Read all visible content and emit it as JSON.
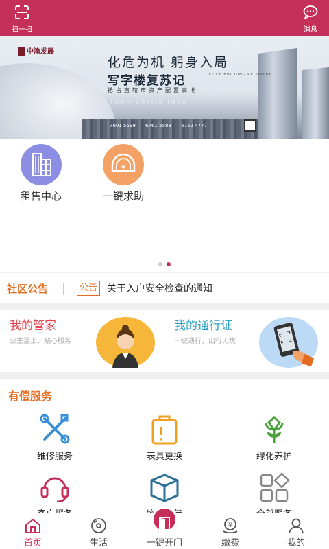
{
  "header": {
    "scan_label": "扫一扫",
    "message_label": "消息"
  },
  "banner": {
    "logo_text": "中渝发展",
    "headline": "化危为机 躬身入局",
    "title": "写字楼复苏记",
    "title_en": "OFFICE BUILDING RECOVERY",
    "tagline": "抢占直辖市资产配置高地",
    "ghost_text": "TURN CRISIS INTO",
    "phones": [
      "7601 5599",
      "6761 5588",
      "6752 4777"
    ]
  },
  "quick_actions": [
    {
      "label": "租售中心",
      "icon": "building-icon",
      "color": "#8c8ee4"
    },
    {
      "label": "一键求助",
      "icon": "help-home-icon",
      "color": "#f4a165"
    }
  ],
  "carousel": {
    "page_count": 2,
    "active_index": 1
  },
  "notice": {
    "title": "社区公告",
    "tag": "公告",
    "text": "关于入户安全检查的通知"
  },
  "cards": {
    "butler": {
      "title": "我的管家",
      "subtitle": "业主至上，贴心服务",
      "color": "#e3474f"
    },
    "pass": {
      "title": "我的通行证",
      "subtitle": "一键通行，出行无忧",
      "color": "#2fa3c4"
    }
  },
  "services": {
    "heading": "有偿服务",
    "items": [
      {
        "label": "维修服务",
        "icon": "tools-icon",
        "color": "#3a8fd6"
      },
      {
        "label": "表具更换",
        "icon": "meter-box-icon",
        "color": "#f0a020"
      },
      {
        "label": "绿化养护",
        "icon": "flower-icon",
        "color": "#4aa23a"
      },
      {
        "label": "客户服务",
        "icon": "headset-icon",
        "color": "#c5305a"
      },
      {
        "label": "物品租借",
        "icon": "package-icon",
        "color": "#2a6f95"
      },
      {
        "label": "全部服务",
        "icon": "grid-icon",
        "color": "#888888"
      }
    ]
  },
  "tabbar": {
    "items": [
      {
        "label": "首页",
        "icon": "home-icon"
      },
      {
        "label": "生活",
        "icon": "music-disc-icon"
      },
      {
        "label": "一键开门",
        "icon": "door-icon"
      },
      {
        "label": "缴费",
        "icon": "payment-icon"
      },
      {
        "label": "我的",
        "icon": "user-icon"
      }
    ],
    "active_index": 0
  },
  "colors": {
    "brand": "#c5305a",
    "accent_orange": "#e36b1e"
  }
}
